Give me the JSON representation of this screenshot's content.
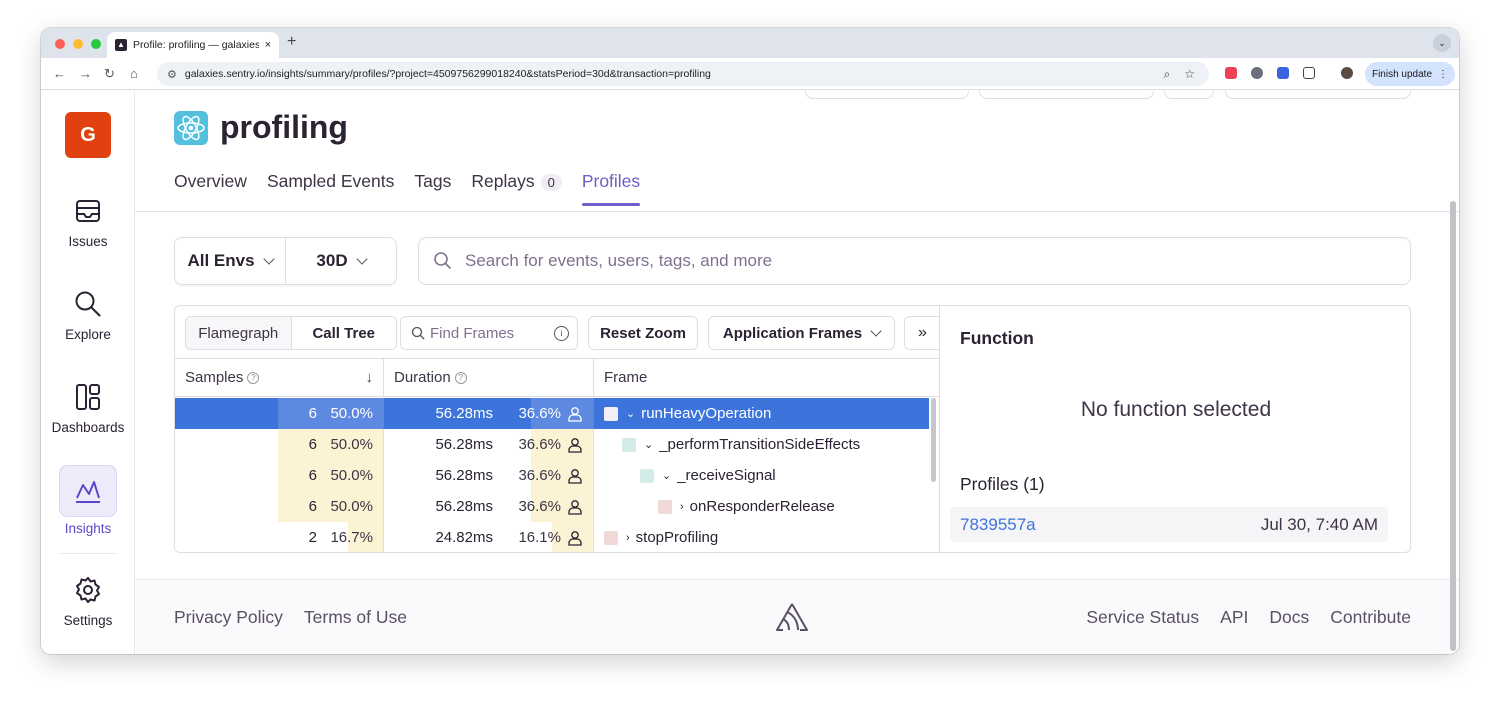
{
  "browser": {
    "tab_title": "Profile: profiling — galaxies —",
    "tab_close": "×",
    "new_tab": "+",
    "url": "galaxies.sentry.io/insights/summary/profiles/?project=4509756299018240&statsPeriod=30d&transaction=profiling",
    "finish_update": "Finish update",
    "menu_glyph": "⋮",
    "tab_menu_glyph": "⌄"
  },
  "sidebar": {
    "org_initial": "G",
    "items": [
      {
        "label": "Issues",
        "icon": "issues-icon"
      },
      {
        "label": "Explore",
        "icon": "search-icon"
      },
      {
        "label": "Dashboards",
        "icon": "dashboards-icon"
      },
      {
        "label": "Insights",
        "icon": "insights-icon"
      },
      {
        "label": "Settings",
        "icon": "gear-icon"
      }
    ],
    "active": "Insights"
  },
  "page": {
    "title": "profiling",
    "tabs": [
      "Overview",
      "Sampled Events",
      "Tags",
      "Replays",
      "Profiles"
    ],
    "replays_count": "0",
    "active_tab": "Profiles"
  },
  "filters": {
    "env": "All Envs",
    "period": "30D",
    "search_placeholder": "Search for events, users, tags, and more"
  },
  "profile_view": {
    "views": [
      "Flamegraph",
      "Call Tree"
    ],
    "active_view": "Call Tree",
    "find_placeholder": "Find Frames",
    "reset_zoom": "Reset Zoom",
    "frames_filter": "Application Frames",
    "expand_glyph": "»",
    "columns": {
      "samples": "Samples",
      "duration": "Duration",
      "frame": "Frame"
    },
    "rows": [
      {
        "samples": "6",
        "samples_pct": "50.0%",
        "samples_frac": 0.5,
        "duration": "56.28ms",
        "duration_pct": "36.6%",
        "duration_frac": 0.366,
        "frame": "runHeavyOperation",
        "depth": 0,
        "expanded": true,
        "swatch": "#f4eef8",
        "selected": true
      },
      {
        "samples": "6",
        "samples_pct": "50.0%",
        "samples_frac": 0.5,
        "duration": "56.28ms",
        "duration_pct": "36.6%",
        "duration_frac": 0.366,
        "frame": "_performTransitionSideEffects",
        "depth": 1,
        "expanded": true,
        "swatch": "#d3ece8",
        "selected": false
      },
      {
        "samples": "6",
        "samples_pct": "50.0%",
        "samples_frac": 0.5,
        "duration": "56.28ms",
        "duration_pct": "36.6%",
        "duration_frac": 0.366,
        "frame": "_receiveSignal",
        "depth": 2,
        "expanded": true,
        "swatch": "#d3ece8",
        "selected": false
      },
      {
        "samples": "6",
        "samples_pct": "50.0%",
        "samples_frac": 0.5,
        "duration": "56.28ms",
        "duration_pct": "36.6%",
        "duration_frac": 0.366,
        "frame": "onResponderRelease",
        "depth": 3,
        "expanded": false,
        "swatch": "#f0d8d6",
        "selected": false
      },
      {
        "samples": "2",
        "samples_pct": "16.7%",
        "samples_frac": 0.167,
        "duration": "24.82ms",
        "duration_pct": "16.1%",
        "duration_frac": 0.161,
        "frame": "stopProfiling",
        "depth": 0,
        "expanded": false,
        "swatch": "#f0d8d6",
        "selected": false
      }
    ]
  },
  "function_panel": {
    "title": "Function",
    "empty": "No function selected",
    "profiles_title": "Profiles (1)",
    "profile_id": "7839557a",
    "profile_time": "Jul 30, 7:40 AM"
  },
  "footer": {
    "left": [
      "Privacy Policy",
      "Terms of Use"
    ],
    "right": [
      "Service Status",
      "API",
      "Docs",
      "Contribute"
    ]
  },
  "colors": {
    "accent": "#6c5fc7",
    "selected_row": "#3d74db",
    "org": "#e1410f"
  }
}
